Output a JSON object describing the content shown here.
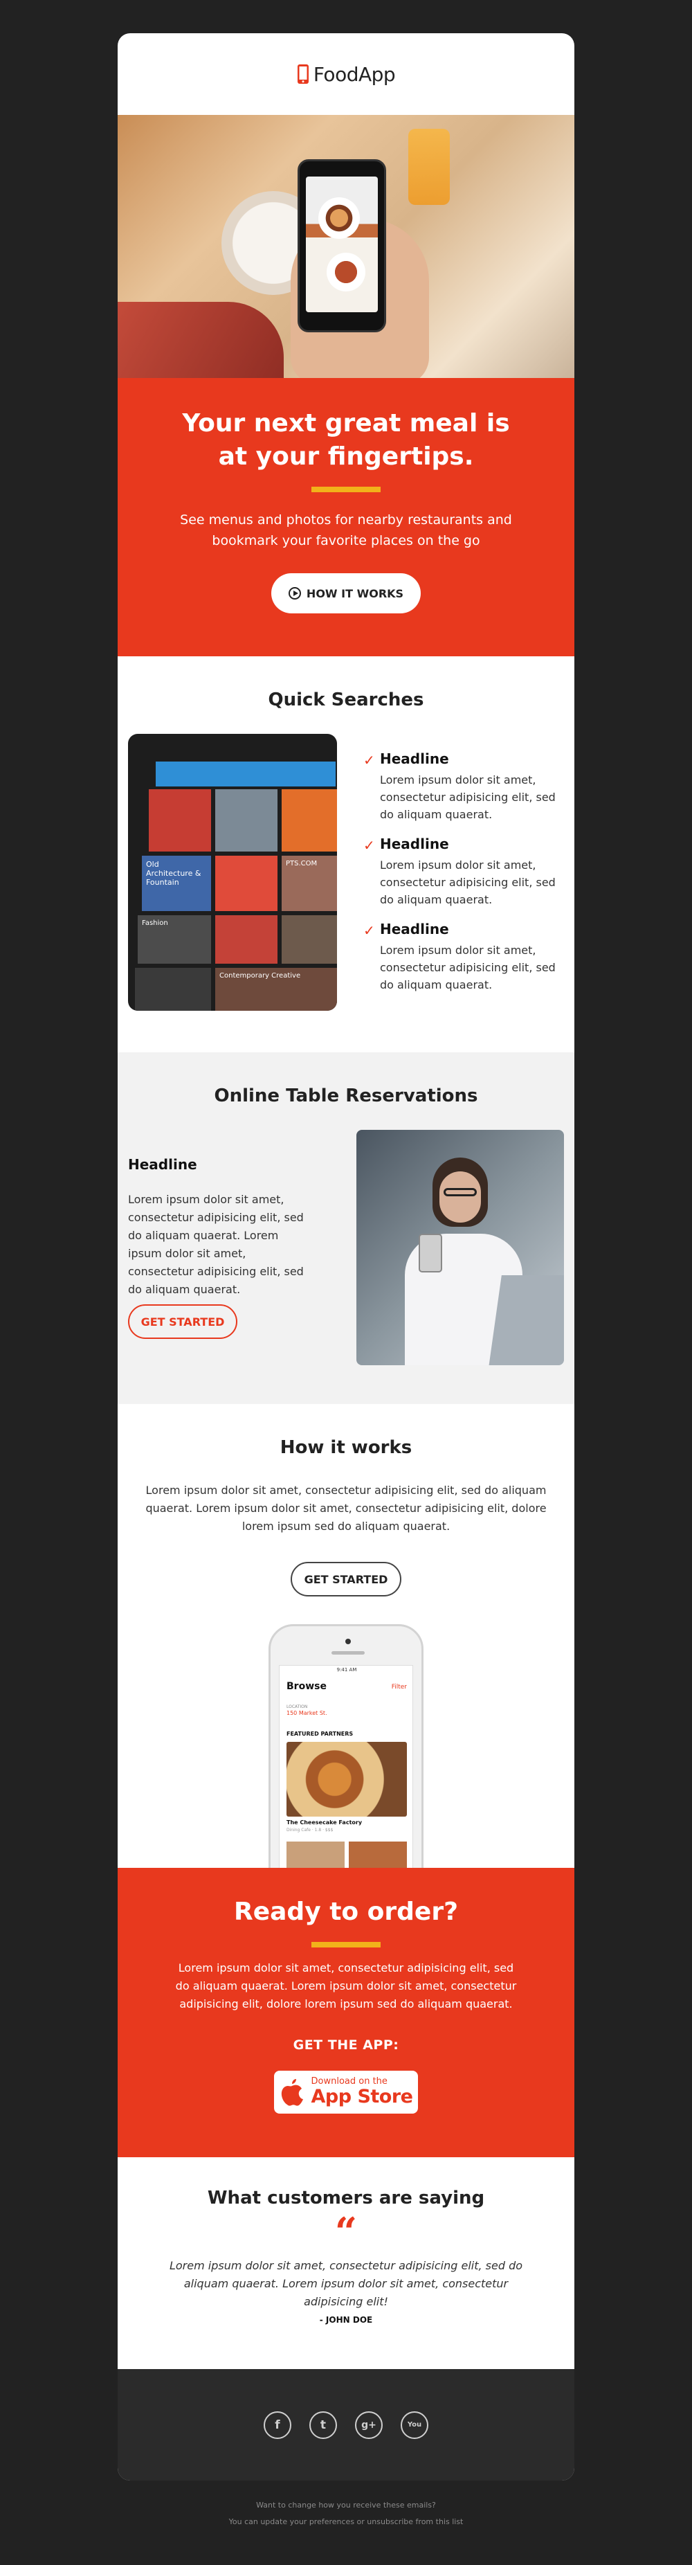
{
  "header": {
    "brand": "FoodApp",
    "logo_icon": "phone-icon",
    "brand_color": "#e8391e"
  },
  "hero": {
    "title": "Your next great meal is at your fingertips.",
    "subtitle": "See menus and photos for nearby restaurants and bookmark your favorite places on the go",
    "button_label": "HOW IT WORKS"
  },
  "quick": {
    "title": "Quick Searches",
    "features": [
      {
        "headline": "Headline",
        "body": "Lorem ipsum dolor sit amet, consectetur adipisicing elit, sed do aliquam quaerat."
      },
      {
        "headline": "Headline",
        "body": "Lorem ipsum dolor sit amet, consectetur adipisicing elit, sed do aliquam quaerat."
      },
      {
        "headline": "Headline",
        "body": "Lorem ipsum dolor sit amet, consectetur adipisicing elit, sed do aliquam quaerat."
      }
    ],
    "tablet": {
      "tile_1": "Old Architecture & Fountain",
      "tile_2": "PTS.COM",
      "tile_3": "Fashion",
      "tile_4": "Contemporary Creative"
    }
  },
  "reservations": {
    "title": "Online Table Reservations",
    "headline": "Headline",
    "body": "Lorem ipsum dolor sit amet, consectetur adipisicing elit, sed do aliquam quaerat. Lorem ipsum dolor sit amet, consectetur adipisicing elit, sed do aliquam quaerat.",
    "button_label": "GET STARTED"
  },
  "how": {
    "title": "How it works",
    "body": "Lorem ipsum dolor sit amet, consectetur adipisicing elit, sed do aliquam quaerat. Lorem ipsum dolor sit amet, consectetur adipisicing elit, dolore lorem ipsum sed do aliquam quaerat.",
    "button_label": "GET STARTED",
    "phone": {
      "status_time": "9:41 AM",
      "screen_title": "Browse",
      "filter": "Filter",
      "location_label": "LOCATION",
      "location": "150 Market St.",
      "featured": "FEATURED PARTNERS",
      "restaurant": "The Cheesecake Factory",
      "restaurant_meta": "Dining Cafe · 1.8 · $$$"
    }
  },
  "ready": {
    "title": "Ready to order?",
    "body": "Lorem ipsum dolor sit amet, consectetur adipisicing elit, sed do aliquam quaerat. Lorem ipsum dolor sit amet, consectetur adipisicing elit, dolore lorem ipsum sed do aliquam quaerat.",
    "get_app": "GET THE APP:",
    "store_small": "Download on the",
    "store_big": "App Store"
  },
  "testimonials": {
    "title": "What customers are saying",
    "quote_mark": "“",
    "quote": "Lorem ipsum dolor sit amet, consectetur adipisicing elit, sed do aliquam quaerat. Lorem ipsum dolor sit amet, consectetur adipisicing elit!",
    "author": "- JOHN DOE"
  },
  "footer": {
    "social": [
      {
        "icon": "facebook-icon",
        "glyph": "f"
      },
      {
        "icon": "twitter-icon",
        "glyph": "t"
      },
      {
        "icon": "google-plus-icon",
        "glyph": "g+"
      },
      {
        "icon": "youtube-icon",
        "glyph": "You"
      }
    ],
    "legal_1": "Want to change how you receive these emails?",
    "legal_2": "You can update your preferences or unsubscribe from this list"
  }
}
